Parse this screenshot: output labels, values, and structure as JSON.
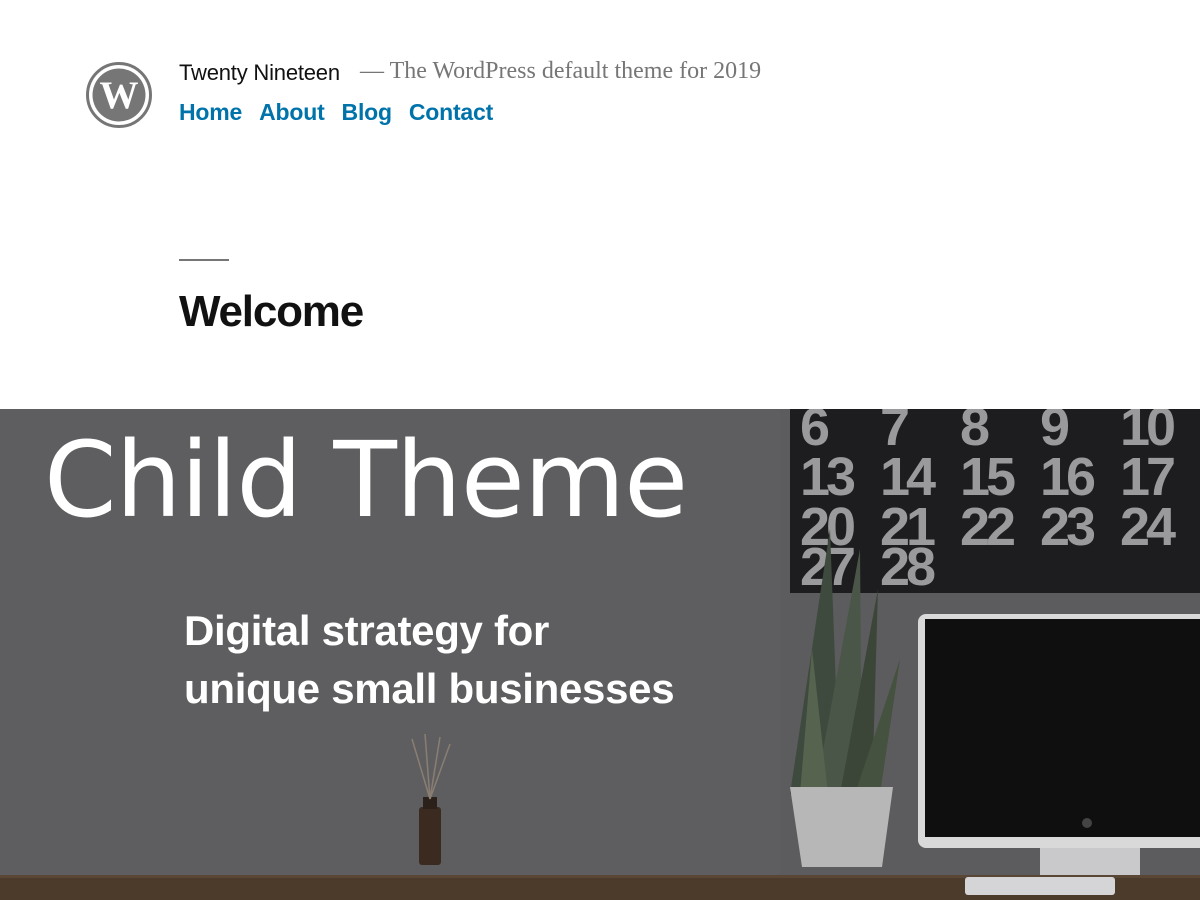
{
  "header": {
    "site_title": "Twenty Nineteen",
    "site_description": "— The WordPress default theme for 2019",
    "logo_icon": "wordpress-logo-icon",
    "nav": [
      {
        "label": "Home"
      },
      {
        "label": "About"
      },
      {
        "label": "Blog"
      },
      {
        "label": "Contact"
      }
    ]
  },
  "entry": {
    "title": "Welcome"
  },
  "hero": {
    "heading": "Child Theme",
    "tagline_line1": "Digital strategy for",
    "tagline_line2": "unique small businesses",
    "calendar_numbers": [
      "6",
      "7",
      "8",
      "9",
      "10",
      "13",
      "14",
      "15",
      "16",
      "17",
      "20",
      "21",
      "22",
      "23",
      "24",
      "27",
      "28"
    ]
  },
  "colors": {
    "link": "#0073aa",
    "title": "#111111",
    "description": "#767676",
    "hero_overlay": "#5b5b5e"
  }
}
